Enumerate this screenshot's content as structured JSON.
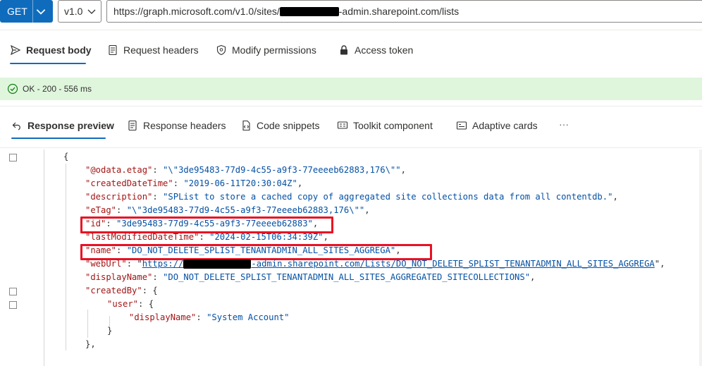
{
  "request": {
    "method": "GET",
    "version": "v1.0",
    "url_prefix": "https://graph.microsoft.com/v1.0/sites/",
    "url_suffix": "-admin.sharepoint.com/lists"
  },
  "request_tabs": [
    {
      "label": "Request body",
      "icon": "send-icon",
      "active": true
    },
    {
      "label": "Request headers",
      "icon": "document-icon",
      "active": false
    },
    {
      "label": "Modify permissions",
      "icon": "shield-icon",
      "active": false
    },
    {
      "label": "Access token",
      "icon": "lock-icon",
      "active": false
    }
  ],
  "status": {
    "text": "OK - 200 - 556 ms",
    "color": "#dff6dd"
  },
  "response_tabs": [
    {
      "label": "Response preview",
      "icon": "arrow-left-icon",
      "active": true
    },
    {
      "label": "Response headers",
      "icon": "document-icon",
      "active": false
    },
    {
      "label": "Code snippets",
      "icon": "code-file-icon",
      "active": false
    },
    {
      "label": "Toolkit component",
      "icon": "toolkit-icon",
      "active": false
    },
    {
      "label": "Adaptive cards",
      "icon": "card-icon",
      "active": false
    },
    {
      "label": "···",
      "icon": "more-icon",
      "active": false
    }
  ],
  "response_json": {
    "open_brace": "{",
    "odata_etag_key": "\"@odata.etag\"",
    "odata_etag_val": "\"\\\"3de95483-77d9-4c55-a9f3-77eeeeb62883,176\\\"\"",
    "created_key": "\"createdDateTime\"",
    "created_val": "\"2019-06-11T20:30:04Z\"",
    "description_key": "\"description\"",
    "description_val": "\"SPList to store a cached copy of aggregated site collections data from all contentdb.\"",
    "etag_key": "\"eTag\"",
    "etag_val": "\"\\\"3de95483-77d9-4c55-a9f3-77eeeeb62883,176\\\"\"",
    "id_key": "\"id\"",
    "id_val": "\"3de95483-77d9-4c55-a9f3-77eeeeb62883\"",
    "modified_key": "\"lastModifiedDateTime\"",
    "modified_val": "\"2024-02-15T06:34:39Z\"",
    "name_key": "\"name\"",
    "name_val": "\"DO_NOT_DELETE_SPLIST_TENANTADMIN_ALL_SITES_AGGREGA\"",
    "weburl_key": "\"webUrl\"",
    "weburl_prefix": "https://",
    "weburl_suffix": "-admin.sharepoint.com/Lists/DO_NOT_DELETE_SPLIST_TENANTADMIN_ALL_SITES_AGGREGA",
    "displayname_key": "\"displayName\"",
    "displayname_val": "\"DO_NOT_DELETE_SPLIST_TENANTADMIN_ALL_SITES_AGGREGATED_SITECOLLECTIONS\"",
    "createdby_key": "\"createdBy\"",
    "user_key": "\"user\"",
    "user_display_key": "\"displayName\"",
    "user_display_val": "\"System Account\"",
    "close_brace": "}",
    "close_obj": "},"
  },
  "colors": {
    "accent": "#0f6cbd",
    "highlight": "#e81123",
    "json_key": "#a31515",
    "json_string": "#0451a5"
  }
}
